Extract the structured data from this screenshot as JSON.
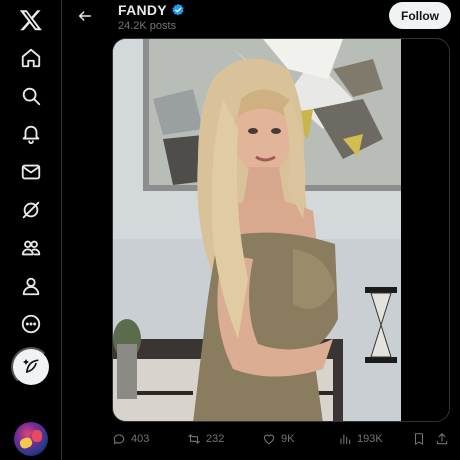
{
  "sidebar": {
    "items": [
      {
        "icon": "x-logo-icon"
      },
      {
        "icon": "home-icon"
      },
      {
        "icon": "search-icon"
      },
      {
        "icon": "bell-icon"
      },
      {
        "icon": "mail-icon"
      },
      {
        "icon": "grok-icon"
      },
      {
        "icon": "communities-icon"
      },
      {
        "icon": "profile-icon"
      },
      {
        "icon": "more-icon"
      }
    ],
    "compose_icon": "feather-plus-icon"
  },
  "header": {
    "account_name": "FANDY",
    "verified": true,
    "post_count": "24.2K posts",
    "follow_label": "Follow"
  },
  "post": {
    "media_alt_icon": "photo",
    "stats": {
      "replies": "403",
      "reposts": "232",
      "likes": "9K",
      "views": "193K"
    }
  },
  "colors": {
    "background": "#000000",
    "text": "#e7e9ea",
    "muted": "#71767b",
    "verified": "#1d9bf0",
    "follow_bg": "#eff3f4"
  }
}
